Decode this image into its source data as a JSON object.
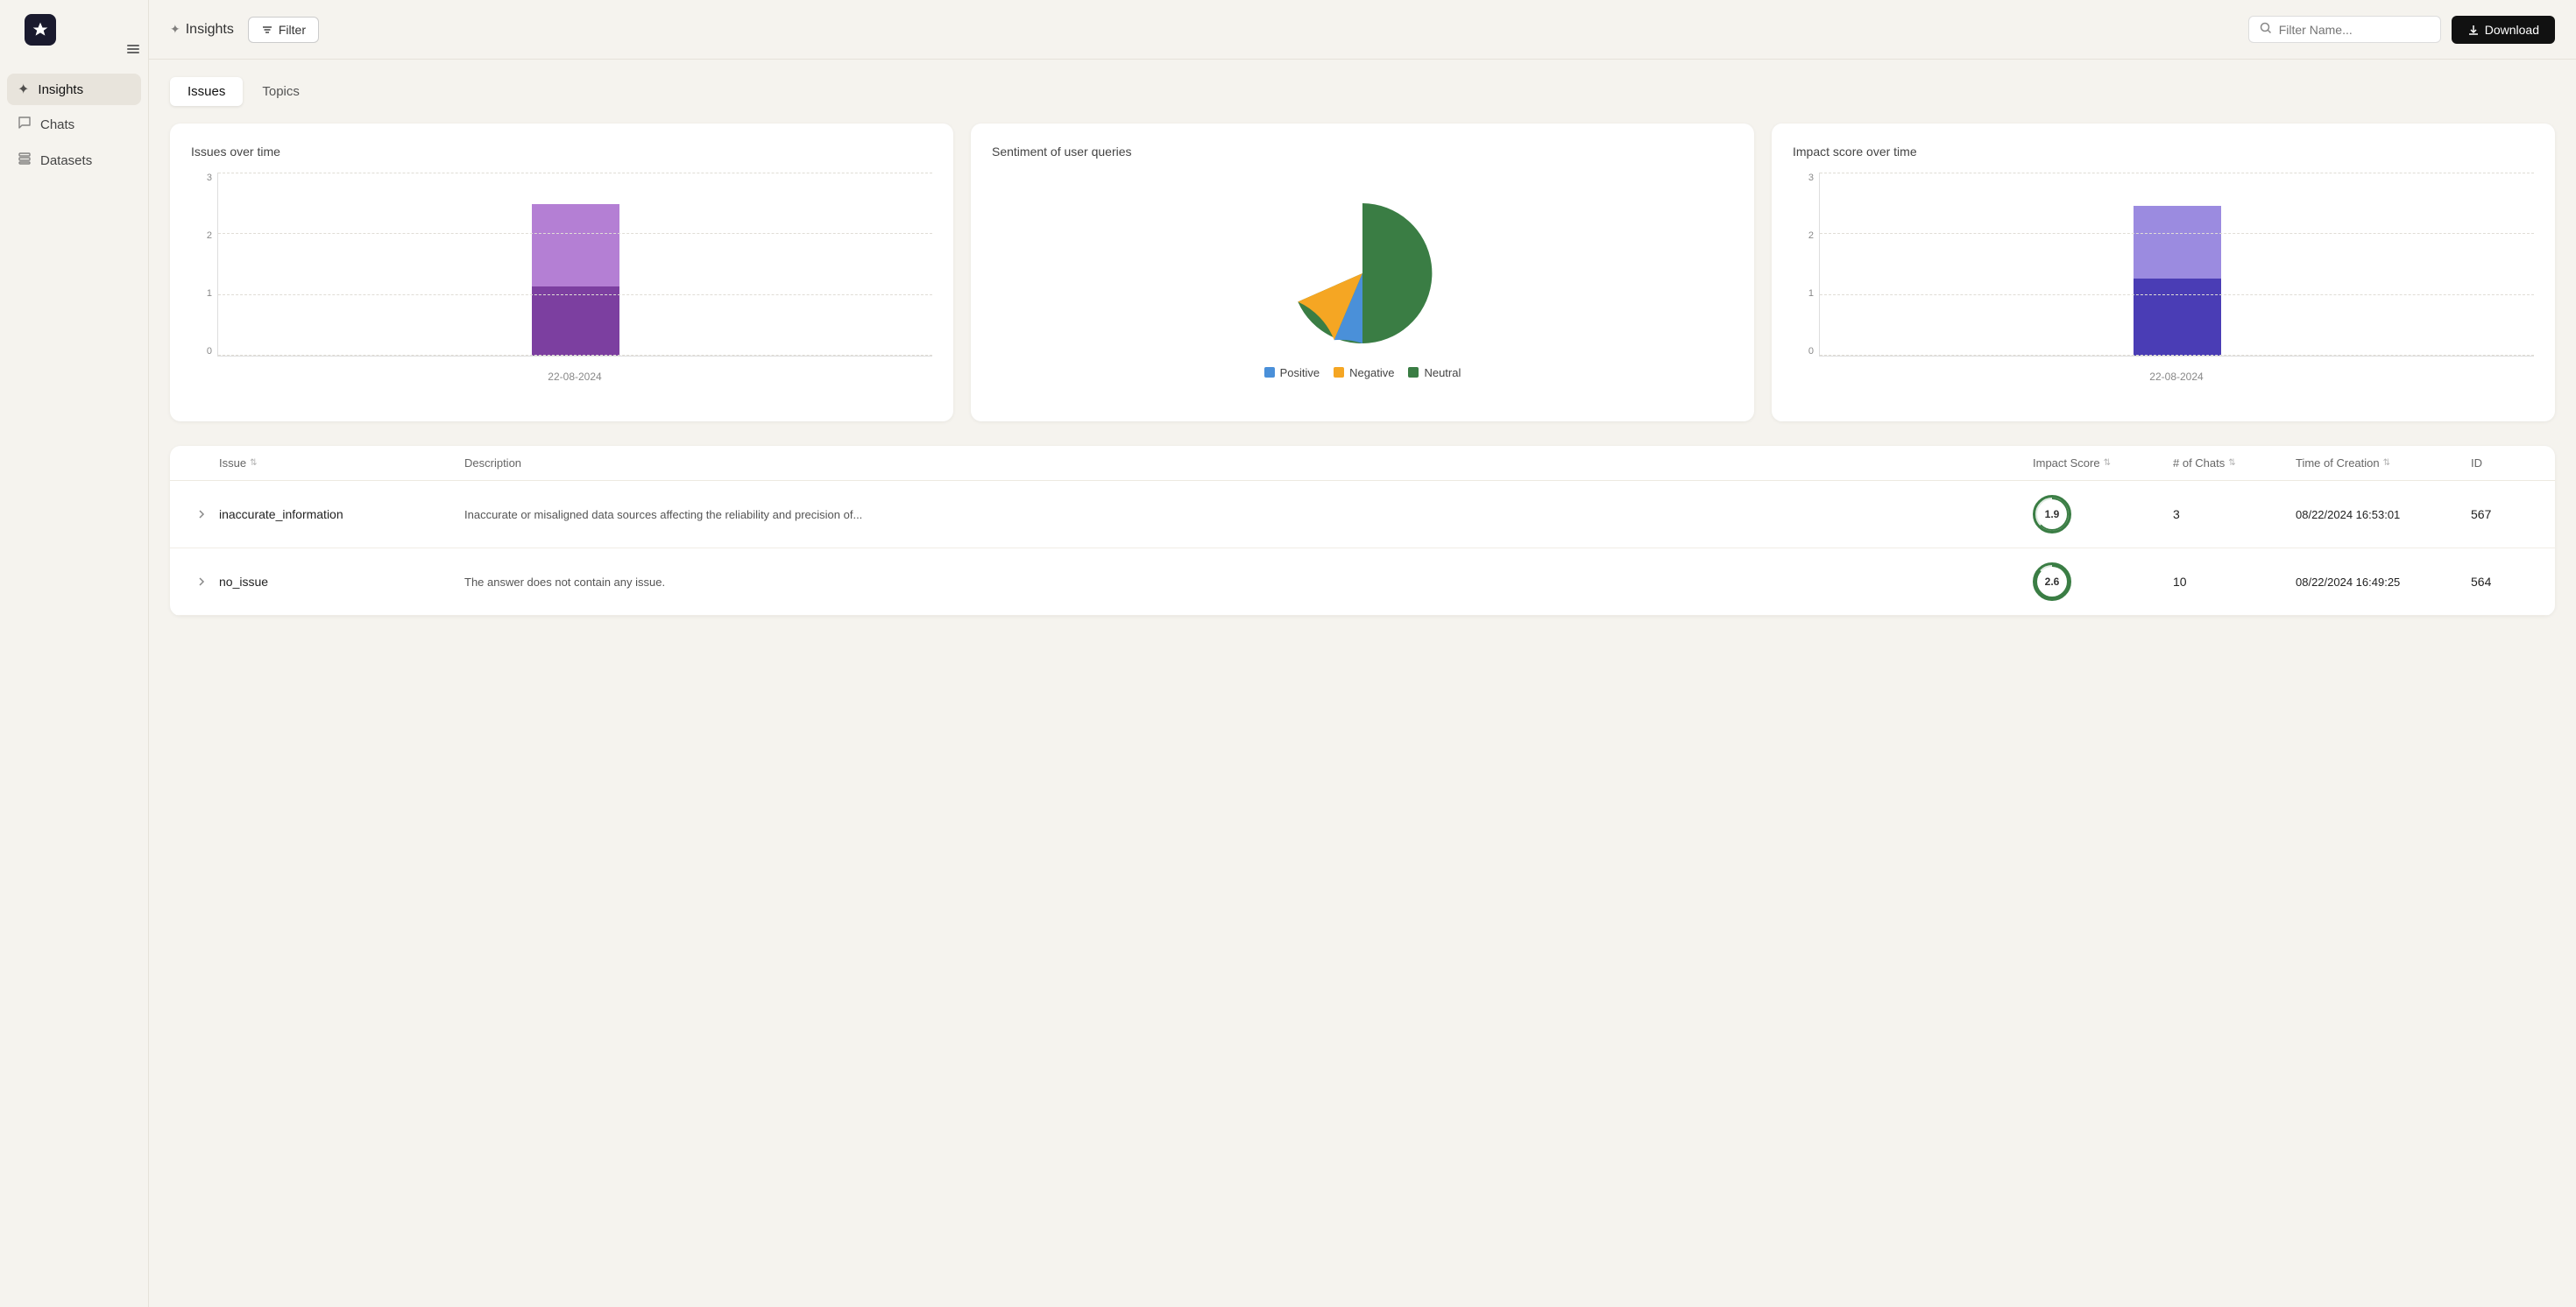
{
  "app": {
    "logo_alt": "App Logo"
  },
  "sidebar": {
    "items": [
      {
        "id": "insights",
        "label": "Insights",
        "icon": "✦",
        "active": true
      },
      {
        "id": "chats",
        "label": "Chats",
        "icon": "💬",
        "active": false
      },
      {
        "id": "datasets",
        "label": "Datasets",
        "icon": "🗂",
        "active": false
      }
    ]
  },
  "header": {
    "breadcrumb_icon": "✦",
    "title": "Insights",
    "filter_label": "Filter",
    "search_placeholder": "Filter Name...",
    "download_label": "Download"
  },
  "tabs": [
    {
      "id": "issues",
      "label": "Issues",
      "active": true
    },
    {
      "id": "topics",
      "label": "Topics",
      "active": false
    }
  ],
  "charts": {
    "issues_over_time": {
      "title": "Issues over time",
      "y_labels": [
        "3",
        "2",
        "1",
        "0"
      ],
      "x_label": "22-08-2024",
      "bars": [
        {
          "color_top": "#b47fd4",
          "color_bottom": "#7c3fa0",
          "height_top": 60,
          "height_bottom": 55
        }
      ]
    },
    "sentiment": {
      "title": "Sentiment of user queries",
      "legend": [
        {
          "label": "Positive",
          "color": "#4a90d9"
        },
        {
          "label": "Negative",
          "color": "#f5a623"
        },
        {
          "label": "Neutral",
          "color": "#3a7d44"
        }
      ],
      "pie": {
        "positive_pct": 8,
        "negative_pct": 14,
        "neutral_pct": 78
      }
    },
    "impact_score": {
      "title": "Impact score over time",
      "y_labels": [
        "3",
        "2",
        "1",
        "0"
      ],
      "x_label": "22-08-2024",
      "bars": [
        {
          "color_top": "#8b7fd4",
          "color_bottom": "#4a3db5",
          "height_top": 55,
          "height_bottom": 60
        }
      ]
    }
  },
  "table": {
    "columns": [
      {
        "id": "expand",
        "label": ""
      },
      {
        "id": "issue",
        "label": "Issue",
        "sortable": true
      },
      {
        "id": "description",
        "label": "Description",
        "sortable": false
      },
      {
        "id": "impact_score",
        "label": "Impact Score",
        "sortable": true
      },
      {
        "id": "num_chats",
        "label": "# of Chats",
        "sortable": true
      },
      {
        "id": "time_of_creation",
        "label": "Time of Creation",
        "sortable": true
      },
      {
        "id": "id",
        "label": "ID",
        "sortable": false
      }
    ],
    "rows": [
      {
        "issue": "inaccurate_information",
        "description": "Inaccurate or misaligned data sources affecting the reliability and precision of...",
        "impact_score": "1.9",
        "impact_color": "#3a7d44",
        "num_chats": "3",
        "time_of_creation": "08/22/2024 16:53:01",
        "id": "567"
      },
      {
        "issue": "no_issue",
        "description": "The answer does not contain any issue.",
        "impact_score": "2.6",
        "impact_color": "#3a7d44",
        "num_chats": "10",
        "time_of_creation": "08/22/2024 16:49:25",
        "id": "564"
      }
    ]
  }
}
